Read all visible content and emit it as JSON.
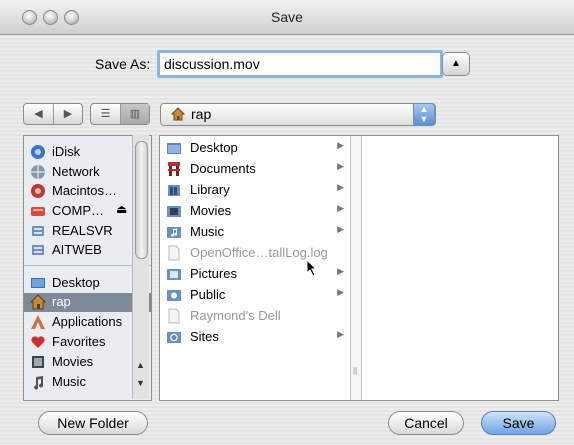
{
  "window": {
    "title": "Save"
  },
  "save_as": {
    "label": "Save As:",
    "value": "discussion.mov"
  },
  "path_popup": {
    "label": "rap",
    "icon": "home-icon"
  },
  "sidebar": {
    "items": [
      {
        "label": "iDisk",
        "icon": "idisk-icon"
      },
      {
        "label": "Network",
        "icon": "network-icon"
      },
      {
        "label": "Macintos…",
        "icon": "hard-disk-icon"
      },
      {
        "label": "COMP…",
        "icon": "drive-icon",
        "eject": "⏏"
      },
      {
        "label": "REALSVR",
        "icon": "server-icon"
      },
      {
        "label": "AITWEB",
        "icon": "server-icon"
      },
      {
        "label": "Desktop",
        "icon": "desktop-icon"
      },
      {
        "label": "rap",
        "icon": "home-icon",
        "selected": true
      },
      {
        "label": "Applications",
        "icon": "applications-icon"
      },
      {
        "label": "Favorites",
        "icon": "heart-icon"
      },
      {
        "label": "Movies",
        "icon": "movies-icon"
      },
      {
        "label": "Music",
        "icon": "music-icon"
      }
    ]
  },
  "browser": {
    "column1": [
      {
        "label": "Desktop",
        "icon": "desktop-folder-icon",
        "has_children": true,
        "enabled": true
      },
      {
        "label": "Documents",
        "icon": "documents-folder-icon",
        "has_children": true,
        "enabled": true
      },
      {
        "label": "Library",
        "icon": "library-folder-icon",
        "has_children": true,
        "enabled": true
      },
      {
        "label": "Movies",
        "icon": "movies-folder-icon",
        "has_children": true,
        "enabled": true
      },
      {
        "label": "Music",
        "icon": "music-folder-icon",
        "has_children": true,
        "enabled": true
      },
      {
        "label": "OpenOffice…tallLog.log",
        "icon": "file-icon",
        "has_children": false,
        "enabled": false
      },
      {
        "label": "Pictures",
        "icon": "pictures-folder-icon",
        "has_children": true,
        "enabled": true
      },
      {
        "label": "Public",
        "icon": "public-folder-icon",
        "has_children": true,
        "enabled": true
      },
      {
        "label": "Raymond's Dell",
        "icon": "file-icon",
        "has_children": false,
        "enabled": false
      },
      {
        "label": "Sites",
        "icon": "sites-folder-icon",
        "has_children": true,
        "enabled": true
      }
    ]
  },
  "buttons": {
    "new_folder": "New Folder",
    "cancel": "Cancel",
    "save": "Save"
  },
  "colors": {
    "focus_ring": "#86b6e8",
    "selection": "#7e8a98",
    "default_button": "#6fa4e3"
  }
}
